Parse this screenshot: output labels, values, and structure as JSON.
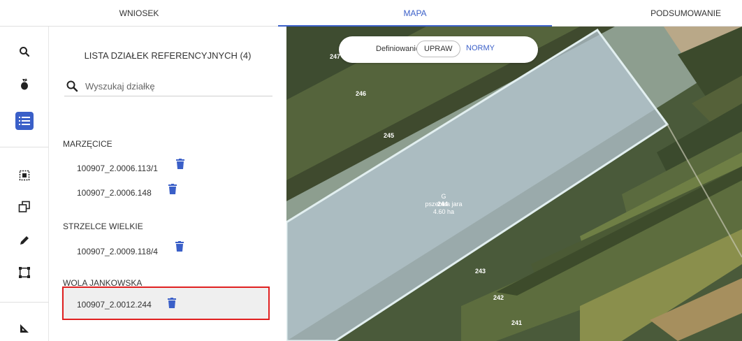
{
  "tabs": [
    {
      "label": "WNIOSEK"
    },
    {
      "label": "MAPA"
    },
    {
      "label": "PODSUMOWANIE"
    }
  ],
  "toolbar": {
    "icons": [
      "search-icon",
      "plant-icon",
      "list-icon",
      "select-area-icon",
      "copy-icon",
      "pencil-icon",
      "frame-icon",
      "measure-icon"
    ],
    "active": "list-icon",
    "accent": "#3a5fc8"
  },
  "panel": {
    "title": "LISTA DZIAŁEK REFERENCYJNYCH (4)",
    "search_placeholder": "Wyszukaj działkę",
    "groups": [
      {
        "name": "MARZĘCICE",
        "parcels": [
          "100907_2.0006.113/1",
          "100907_2.0006.148"
        ]
      },
      {
        "name": "STRZELCE WIELKIE",
        "parcels": [
          "100907_2.0009.118/4"
        ]
      },
      {
        "name": "WOLA JANKOWSKA",
        "parcels": [
          "100907_2.0012.244"
        ]
      }
    ],
    "highlight_color": "#e02020"
  },
  "map": {
    "mode_label": "Definiowanie",
    "mode_upraw": "UPRAW",
    "mode_normy": "NORMY",
    "labels": [
      "247",
      "246",
      "245",
      "243",
      "242",
      "241"
    ],
    "selected": {
      "letter": "G",
      "crop": "pszenica jara",
      "id": "244",
      "area": "4.60 ha"
    }
  }
}
